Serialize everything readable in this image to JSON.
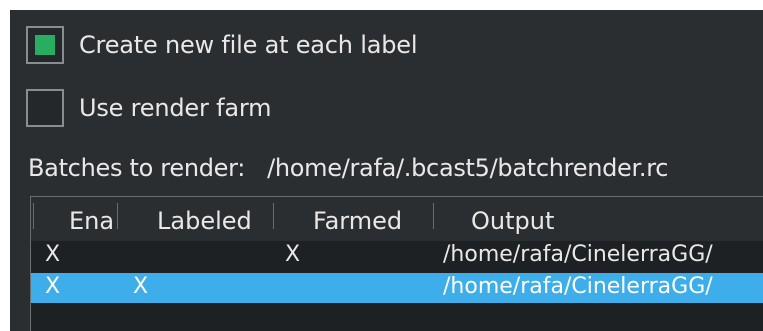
{
  "options": {
    "create_new_file": {
      "label": "Create new file at each label",
      "checked": true
    },
    "use_render_farm": {
      "label": "Use render farm",
      "checked": false
    }
  },
  "batches": {
    "label": "Batches to render:",
    "path": "/home/rafa/.bcast5/batchrender.rc"
  },
  "table": {
    "headers": {
      "enabled": "Ena",
      "labeled": "Labeled",
      "farmed": "Farmed",
      "output": "Output"
    },
    "rows": [
      {
        "enabled": "X",
        "labeled": "",
        "farmed": "X",
        "output": "/home/rafa/CinelerraGG/",
        "selected": false
      },
      {
        "enabled": "X",
        "labeled": "X",
        "farmed": "",
        "output": "/home/rafa/CinelerraGG/",
        "selected": true
      }
    ]
  },
  "colors": {
    "background": "#2b2e31",
    "checkbox_checked": "#27ae60",
    "selection": "#3daee9"
  }
}
